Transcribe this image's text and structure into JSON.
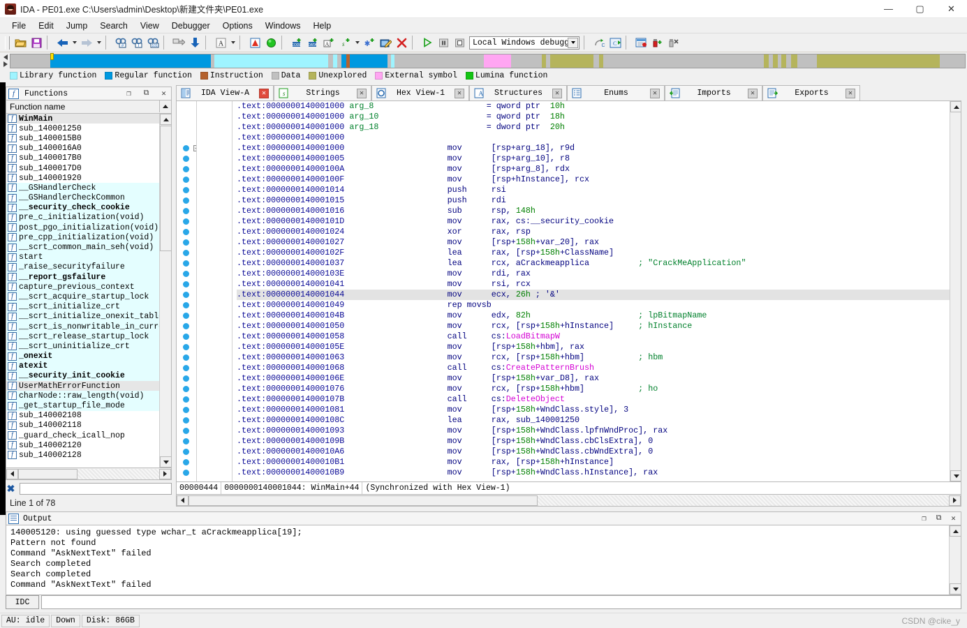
{
  "window": {
    "title": "IDA - PE01.exe C:\\Users\\admin\\Desktop\\新建文件夹\\PE01.exe",
    "icon": "ida-logo-icon",
    "minimize": "—",
    "maximize": "▢",
    "close": "✕"
  },
  "menu": [
    "File",
    "Edit",
    "Jump",
    "Search",
    "View",
    "Debugger",
    "Options",
    "Windows",
    "Help"
  ],
  "toolbar": {
    "debugger_select": "Local Windows debugger",
    "icons": [
      "open-file-icon",
      "save-icon",
      "back-arrow-icon",
      "forward-arrow-icon",
      "search-hash-icon",
      "search-text-icon",
      "search-binary-icon",
      "jump-icon",
      "down-arrow-icon",
      "text-style-icon",
      "graph-icon",
      "green-circle-icon",
      "make-code-icon",
      "make-data-icon",
      "make-ascii-icon",
      "make-struct-icon",
      "make-array-icon",
      "edit-function-icon",
      "undefine-icon",
      "run-icon",
      "pause-icon",
      "stop-icon",
      "step-over-icon",
      "step-into-icon",
      "breakpoint-list-icon",
      "add-breakpoint-icon",
      "delete-breakpoint-icon"
    ]
  },
  "navband": {
    "cursor_left_pct": 4.2,
    "segments": [
      {
        "color": "#c0c0c0",
        "pct": 4.2
      },
      {
        "color": "#0099e0",
        "pct": 17.0
      },
      {
        "color": "#c0c0c0",
        "pct": 0.4
      },
      {
        "color": "#9ff4ff",
        "pct": 12.0
      },
      {
        "color": "#c0c0c0",
        "pct": 0.5
      },
      {
        "color": "#9ff4ff",
        "pct": 0.5
      },
      {
        "color": "#c0c0c0",
        "pct": 0.4
      },
      {
        "color": "#0099e0",
        "pct": 0.5
      },
      {
        "color": "#b5622e",
        "pct": 0.4
      },
      {
        "color": "#0099e0",
        "pct": 4.0
      },
      {
        "color": "#c0c0c0",
        "pct": 0.4
      },
      {
        "color": "#9ff4ff",
        "pct": 0.3
      },
      {
        "color": "#c0c0c0",
        "pct": 9.5
      },
      {
        "color": "#ffa6f2",
        "pct": 2.9
      },
      {
        "color": "#c0c0c0",
        "pct": 3.2
      },
      {
        "color": "#b5b45c",
        "pct": 0.5
      },
      {
        "color": "#c0c0c0",
        "pct": 0.4
      },
      {
        "color": "#b5b45c",
        "pct": 4.6
      },
      {
        "color": "#c0c0c0",
        "pct": 0.6
      },
      {
        "color": "#b5b45c",
        "pct": 0.4
      },
      {
        "color": "#c0c0c0",
        "pct": 17.0
      },
      {
        "color": "#b5b45c",
        "pct": 0.5
      },
      {
        "color": "#c0c0c0",
        "pct": 0.5
      },
      {
        "color": "#b5b45c",
        "pct": 0.5
      },
      {
        "color": "#c0c0c0",
        "pct": 0.4
      },
      {
        "color": "#b5b45c",
        "pct": 0.5
      },
      {
        "color": "#c0c0c0",
        "pct": 0.5
      },
      {
        "color": "#b5b45c",
        "pct": 0.7
      },
      {
        "color": "#c0c0c0",
        "pct": 2.0
      },
      {
        "color": "#b5b45c",
        "pct": 13.0
      },
      {
        "color": "#c0c0c0",
        "pct": 2.7
      }
    ]
  },
  "legend": [
    {
      "label": "Library function",
      "color": "#9ff4ff"
    },
    {
      "label": "Regular function",
      "color": "#0099e0"
    },
    {
      "label": "Instruction",
      "color": "#b5622e"
    },
    {
      "label": "Data",
      "color": "#c0c0c0"
    },
    {
      "label": "Unexplored",
      "color": "#b5b45c"
    },
    {
      "label": "External symbol",
      "color": "#ffa6f2"
    },
    {
      "label": "Lumina function",
      "color": "#13c413"
    }
  ],
  "functions_panel": {
    "title": "Functions",
    "title_icon": "functions-f-icon",
    "column_header": "Function name",
    "filter_icon": "filter-clear-icon",
    "line_count": "Line 1 of 78",
    "rows": [
      {
        "name": "WinMain",
        "lib": false,
        "bold": true,
        "selected": true
      },
      {
        "name": "sub_140001250",
        "lib": false,
        "bold": false,
        "selected": false
      },
      {
        "name": "sub_1400015B0",
        "lib": false,
        "bold": false,
        "selected": false
      },
      {
        "name": "sub_1400016A0",
        "lib": false,
        "bold": false,
        "selected": false
      },
      {
        "name": "sub_1400017B0",
        "lib": false,
        "bold": false,
        "selected": false
      },
      {
        "name": "sub_1400017D0",
        "lib": false,
        "bold": false,
        "selected": false
      },
      {
        "name": "sub_140001920",
        "lib": false,
        "bold": false,
        "selected": false
      },
      {
        "name": "__GSHandlerCheck",
        "lib": true,
        "bold": false,
        "selected": false
      },
      {
        "name": "__GSHandlerCheckCommon",
        "lib": true,
        "bold": false,
        "selected": false
      },
      {
        "name": "__security_check_cookie",
        "lib": true,
        "bold": true,
        "selected": false
      },
      {
        "name": "pre_c_initialization(void)",
        "lib": true,
        "bold": false,
        "selected": false
      },
      {
        "name": "post_pgo_initialization(void)",
        "lib": true,
        "bold": false,
        "selected": false
      },
      {
        "name": "pre_cpp_initialization(void)",
        "lib": true,
        "bold": false,
        "selected": false
      },
      {
        "name": "__scrt_common_main_seh(void)",
        "lib": true,
        "bold": false,
        "selected": false
      },
      {
        "name": "start",
        "lib": true,
        "bold": false,
        "selected": false
      },
      {
        "name": "_raise_securityfailure",
        "lib": true,
        "bold": false,
        "selected": false
      },
      {
        "name": "__report_gsfailure",
        "lib": true,
        "bold": true,
        "selected": false
      },
      {
        "name": "capture_previous_context",
        "lib": true,
        "bold": false,
        "selected": false
      },
      {
        "name": "__scrt_acquire_startup_lock",
        "lib": true,
        "bold": false,
        "selected": false
      },
      {
        "name": "__scrt_initialize_crt",
        "lib": true,
        "bold": false,
        "selected": false
      },
      {
        "name": "__scrt_initialize_onexit_tables",
        "lib": true,
        "bold": false,
        "selected": false
      },
      {
        "name": "__scrt_is_nonwritable_in_current",
        "lib": true,
        "bold": false,
        "selected": false
      },
      {
        "name": "__scrt_release_startup_lock",
        "lib": true,
        "bold": false,
        "selected": false
      },
      {
        "name": "__scrt_uninitialize_crt",
        "lib": true,
        "bold": false,
        "selected": false
      },
      {
        "name": "_onexit",
        "lib": true,
        "bold": true,
        "selected": false
      },
      {
        "name": "atexit",
        "lib": true,
        "bold": true,
        "selected": false
      },
      {
        "name": "__security_init_cookie",
        "lib": true,
        "bold": true,
        "selected": false
      },
      {
        "name": "UserMathErrorFunction",
        "lib": true,
        "bold": false,
        "selected": true
      },
      {
        "name": "charNode::raw_length(void)",
        "lib": true,
        "bold": false,
        "selected": false
      },
      {
        "name": "_get_startup_file_mode",
        "lib": true,
        "bold": false,
        "selected": false
      },
      {
        "name": "sub_140002108",
        "lib": false,
        "bold": false,
        "selected": false
      },
      {
        "name": "sub_140002118",
        "lib": false,
        "bold": false,
        "selected": false
      },
      {
        "name": "_guard_check_icall_nop",
        "lib": false,
        "bold": false,
        "selected": false
      },
      {
        "name": "sub_140002120",
        "lib": false,
        "bold": false,
        "selected": false
      },
      {
        "name": "sub_140002128",
        "lib": false,
        "bold": false,
        "selected": false
      }
    ]
  },
  "tabs": [
    {
      "label": "IDA View-A",
      "icon": "ida-view-icon",
      "active": true,
      "close": "✕"
    },
    {
      "label": "Strings",
      "icon": "strings-icon",
      "active": false,
      "close": "✕"
    },
    {
      "label": "Hex View-1",
      "icon": "hex-view-icon",
      "active": false,
      "close": "✕"
    },
    {
      "label": "Structures",
      "icon": "structures-icon",
      "active": false,
      "close": "✕"
    },
    {
      "label": "Enums",
      "icon": "enums-icon",
      "active": false,
      "close": "✕"
    },
    {
      "label": "Imports",
      "icon": "imports-icon",
      "active": false,
      "close": "✕"
    },
    {
      "label": "Exports",
      "icon": "exports-icon",
      "active": false,
      "close": "✕"
    }
  ],
  "disassembly": {
    "status_offset": "00000444",
    "status_location": "0000000140001044: WinMain+44",
    "status_sync": "(Synchronized with Hex View-1)",
    "lines": [
      {
        "addr": ".text:0000000140001000",
        "var": "arg_8",
        "eq": "= qword ptr",
        "num": "10h",
        "mnem": "",
        "ops": "",
        "comment": "",
        "hl": false,
        "dot": false
      },
      {
        "addr": ".text:0000000140001000",
        "var": "arg_10",
        "eq": "= qword ptr",
        "num": "18h",
        "mnem": "",
        "ops": "",
        "comment": "",
        "hl": false,
        "dot": false
      },
      {
        "addr": ".text:0000000140001000",
        "var": "arg_18",
        "eq": "= dword ptr",
        "num": "20h",
        "mnem": "",
        "ops": "",
        "comment": "",
        "hl": false,
        "dot": false
      },
      {
        "addr": ".text:0000000140001000",
        "var": "",
        "eq": "",
        "num": "",
        "mnem": "",
        "ops": "",
        "comment": "",
        "hl": false,
        "dot": false
      },
      {
        "addr": ".text:0000000140001000",
        "var": "",
        "eq": "",
        "num": "",
        "mnem": "mov",
        "ops": "[rsp+arg_18], r9d",
        "comment": "",
        "hl": false,
        "dot": true,
        "collapse": true
      },
      {
        "addr": ".text:0000000140001005",
        "var": "",
        "eq": "",
        "num": "",
        "mnem": "mov",
        "ops": "[rsp+arg_10], r8",
        "comment": "",
        "hl": false,
        "dot": true
      },
      {
        "addr": ".text:000000014000100A",
        "var": "",
        "eq": "",
        "num": "",
        "mnem": "mov",
        "ops": "[rsp+arg_8], rdx",
        "comment": "",
        "hl": false,
        "dot": true
      },
      {
        "addr": ".text:000000014000100F",
        "var": "",
        "eq": "",
        "num": "",
        "mnem": "mov",
        "ops": "[rsp+hInstance], rcx",
        "comment": "",
        "hl": false,
        "dot": true
      },
      {
        "addr": ".text:0000000140001014",
        "var": "",
        "eq": "",
        "num": "",
        "mnem": "push",
        "ops": "rsi",
        "comment": "",
        "hl": false,
        "dot": true
      },
      {
        "addr": ".text:0000000140001015",
        "var": "",
        "eq": "",
        "num": "",
        "mnem": "push",
        "ops": "rdi",
        "comment": "",
        "hl": false,
        "dot": true
      },
      {
        "addr": ".text:0000000140001016",
        "var": "",
        "eq": "",
        "num": "",
        "mnem": "sub",
        "ops": "rsp, 148h",
        "comment": "",
        "hl": false,
        "dot": true
      },
      {
        "addr": ".text:000000014000101D",
        "var": "",
        "eq": "",
        "num": "",
        "mnem": "mov",
        "ops": "rax, cs:__security_cookie",
        "comment": "",
        "hl": false,
        "dot": true
      },
      {
        "addr": ".text:0000000140001024",
        "var": "",
        "eq": "",
        "num": "",
        "mnem": "xor",
        "ops": "rax, rsp",
        "comment": "",
        "hl": false,
        "dot": true
      },
      {
        "addr": ".text:0000000140001027",
        "var": "",
        "eq": "",
        "num": "",
        "mnem": "mov",
        "ops": "[rsp+158h+var_20], rax",
        "comment": "",
        "hl": false,
        "dot": true
      },
      {
        "addr": ".text:000000014000102F",
        "var": "",
        "eq": "",
        "num": "",
        "mnem": "lea",
        "ops": "rax, [rsp+158h+ClassName]",
        "comment": "",
        "hl": false,
        "dot": true
      },
      {
        "addr": ".text:0000000140001037",
        "var": "",
        "eq": "",
        "num": "",
        "mnem": "lea",
        "ops": "rcx, aCrackmeapplica",
        "comment": "; \"CrackMeApplication\"",
        "hl": false,
        "dot": true
      },
      {
        "addr": ".text:000000014000103E",
        "var": "",
        "eq": "",
        "num": "",
        "mnem": "mov",
        "ops": "rdi, rax",
        "comment": "",
        "hl": false,
        "dot": true
      },
      {
        "addr": ".text:0000000140001041",
        "var": "",
        "eq": "",
        "num": "",
        "mnem": "mov",
        "ops": "rsi, rcx",
        "comment": "",
        "hl": false,
        "dot": true
      },
      {
        "addr": ".text:0000000140001044",
        "var": "",
        "eq": "",
        "num": "",
        "mnem": "mov",
        "ops": "ecx, 26h ; '&'",
        "comment": "",
        "hl": true,
        "dot": true
      },
      {
        "addr": ".text:0000000140001049",
        "var": "",
        "eq": "",
        "num": "",
        "mnem": "rep movsb",
        "ops": "",
        "comment": "",
        "hl": false,
        "dot": true
      },
      {
        "addr": ".text:000000014000104B",
        "var": "",
        "eq": "",
        "num": "",
        "mnem": "mov",
        "ops": "edx, 82h",
        "comment": "; lpBitmapName",
        "hl": false,
        "dot": true
      },
      {
        "addr": ".text:0000000140001050",
        "var": "",
        "eq": "",
        "num": "",
        "mnem": "mov",
        "ops": "rcx, [rsp+158h+hInstance]",
        "comment": "; hInstance",
        "hl": false,
        "dot": true
      },
      {
        "addr": ".text:0000000140001058",
        "var": "",
        "eq": "",
        "num": "",
        "mnem": "call",
        "ops": "cs:LoadBitmapW",
        "comment": "",
        "hl": false,
        "dot": true,
        "api": true
      },
      {
        "addr": ".text:000000014000105E",
        "var": "",
        "eq": "",
        "num": "",
        "mnem": "mov",
        "ops": "[rsp+158h+hbm], rax",
        "comment": "",
        "hl": false,
        "dot": true
      },
      {
        "addr": ".text:0000000140001063",
        "var": "",
        "eq": "",
        "num": "",
        "mnem": "mov",
        "ops": "rcx, [rsp+158h+hbm]",
        "comment": "; hbm",
        "hl": false,
        "dot": true
      },
      {
        "addr": ".text:0000000140001068",
        "var": "",
        "eq": "",
        "num": "",
        "mnem": "call",
        "ops": "cs:CreatePatternBrush",
        "comment": "",
        "hl": false,
        "dot": true,
        "api": true
      },
      {
        "addr": ".text:000000014000106E",
        "var": "",
        "eq": "",
        "num": "",
        "mnem": "mov",
        "ops": "[rsp+158h+var_D8], rax",
        "comment": "",
        "hl": false,
        "dot": true
      },
      {
        "addr": ".text:0000000140001076",
        "var": "",
        "eq": "",
        "num": "",
        "mnem": "mov",
        "ops": "rcx, [rsp+158h+hbm]",
        "comment": "; ho",
        "hl": false,
        "dot": true
      },
      {
        "addr": ".text:000000014000107B",
        "var": "",
        "eq": "",
        "num": "",
        "mnem": "call",
        "ops": "cs:DeleteObject",
        "comment": "",
        "hl": false,
        "dot": true,
        "api": true
      },
      {
        "addr": ".text:0000000140001081",
        "var": "",
        "eq": "",
        "num": "",
        "mnem": "mov",
        "ops": "[rsp+158h+WndClass.style], 3",
        "comment": "",
        "hl": false,
        "dot": true
      },
      {
        "addr": ".text:000000014000108C",
        "var": "",
        "eq": "",
        "num": "",
        "mnem": "lea",
        "ops": "rax, sub_140001250",
        "comment": "",
        "hl": false,
        "dot": true
      },
      {
        "addr": ".text:0000000140001093",
        "var": "",
        "eq": "",
        "num": "",
        "mnem": "mov",
        "ops": "[rsp+158h+WndClass.lpfnWndProc], rax",
        "comment": "",
        "hl": false,
        "dot": true
      },
      {
        "addr": ".text:000000014000109B",
        "var": "",
        "eq": "",
        "num": "",
        "mnem": "mov",
        "ops": "[rsp+158h+WndClass.cbClsExtra], 0",
        "comment": "",
        "hl": false,
        "dot": true
      },
      {
        "addr": ".text:00000001400010A6",
        "var": "",
        "eq": "",
        "num": "",
        "mnem": "mov",
        "ops": "[rsp+158h+WndClass.cbWndExtra], 0",
        "comment": "",
        "hl": false,
        "dot": true
      },
      {
        "addr": ".text:00000001400010B1",
        "var": "",
        "eq": "",
        "num": "",
        "mnem": "mov",
        "ops": "rax, [rsp+158h+hInstance]",
        "comment": "",
        "hl": false,
        "dot": true
      },
      {
        "addr": ".text:00000001400010B9",
        "var": "",
        "eq": "",
        "num": "",
        "mnem": "mov",
        "ops": "[rsp+158h+WndClass.hInstance], rax",
        "comment": "",
        "hl": false,
        "dot": true
      }
    ]
  },
  "output_panel": {
    "title": "Output",
    "title_icon": "output-lines-icon",
    "lines": [
      "140005120: using guessed type wchar_t aCrackmeapplica[19];",
      "Pattern not found",
      "Command \"AskNextText\" failed",
      "Search completed",
      "Search completed",
      "Command \"AskNextText\" failed"
    ]
  },
  "idc_bar": {
    "button_label": "IDC",
    "input_value": "",
    "input_placeholder": ""
  },
  "statusbar": {
    "au": "AU: idle",
    "direction": "Down",
    "disk": "Disk: 86GB",
    "watermark": "CSDN @cike_y"
  },
  "colors": {
    "address": "#0a0a96",
    "mnemonic": "#00007f",
    "number": "#007f00",
    "api_call": "#d400d4",
    "comment": "#00802b",
    "highlight_row": "#e3e3e3",
    "library_row": "#e4feff"
  }
}
